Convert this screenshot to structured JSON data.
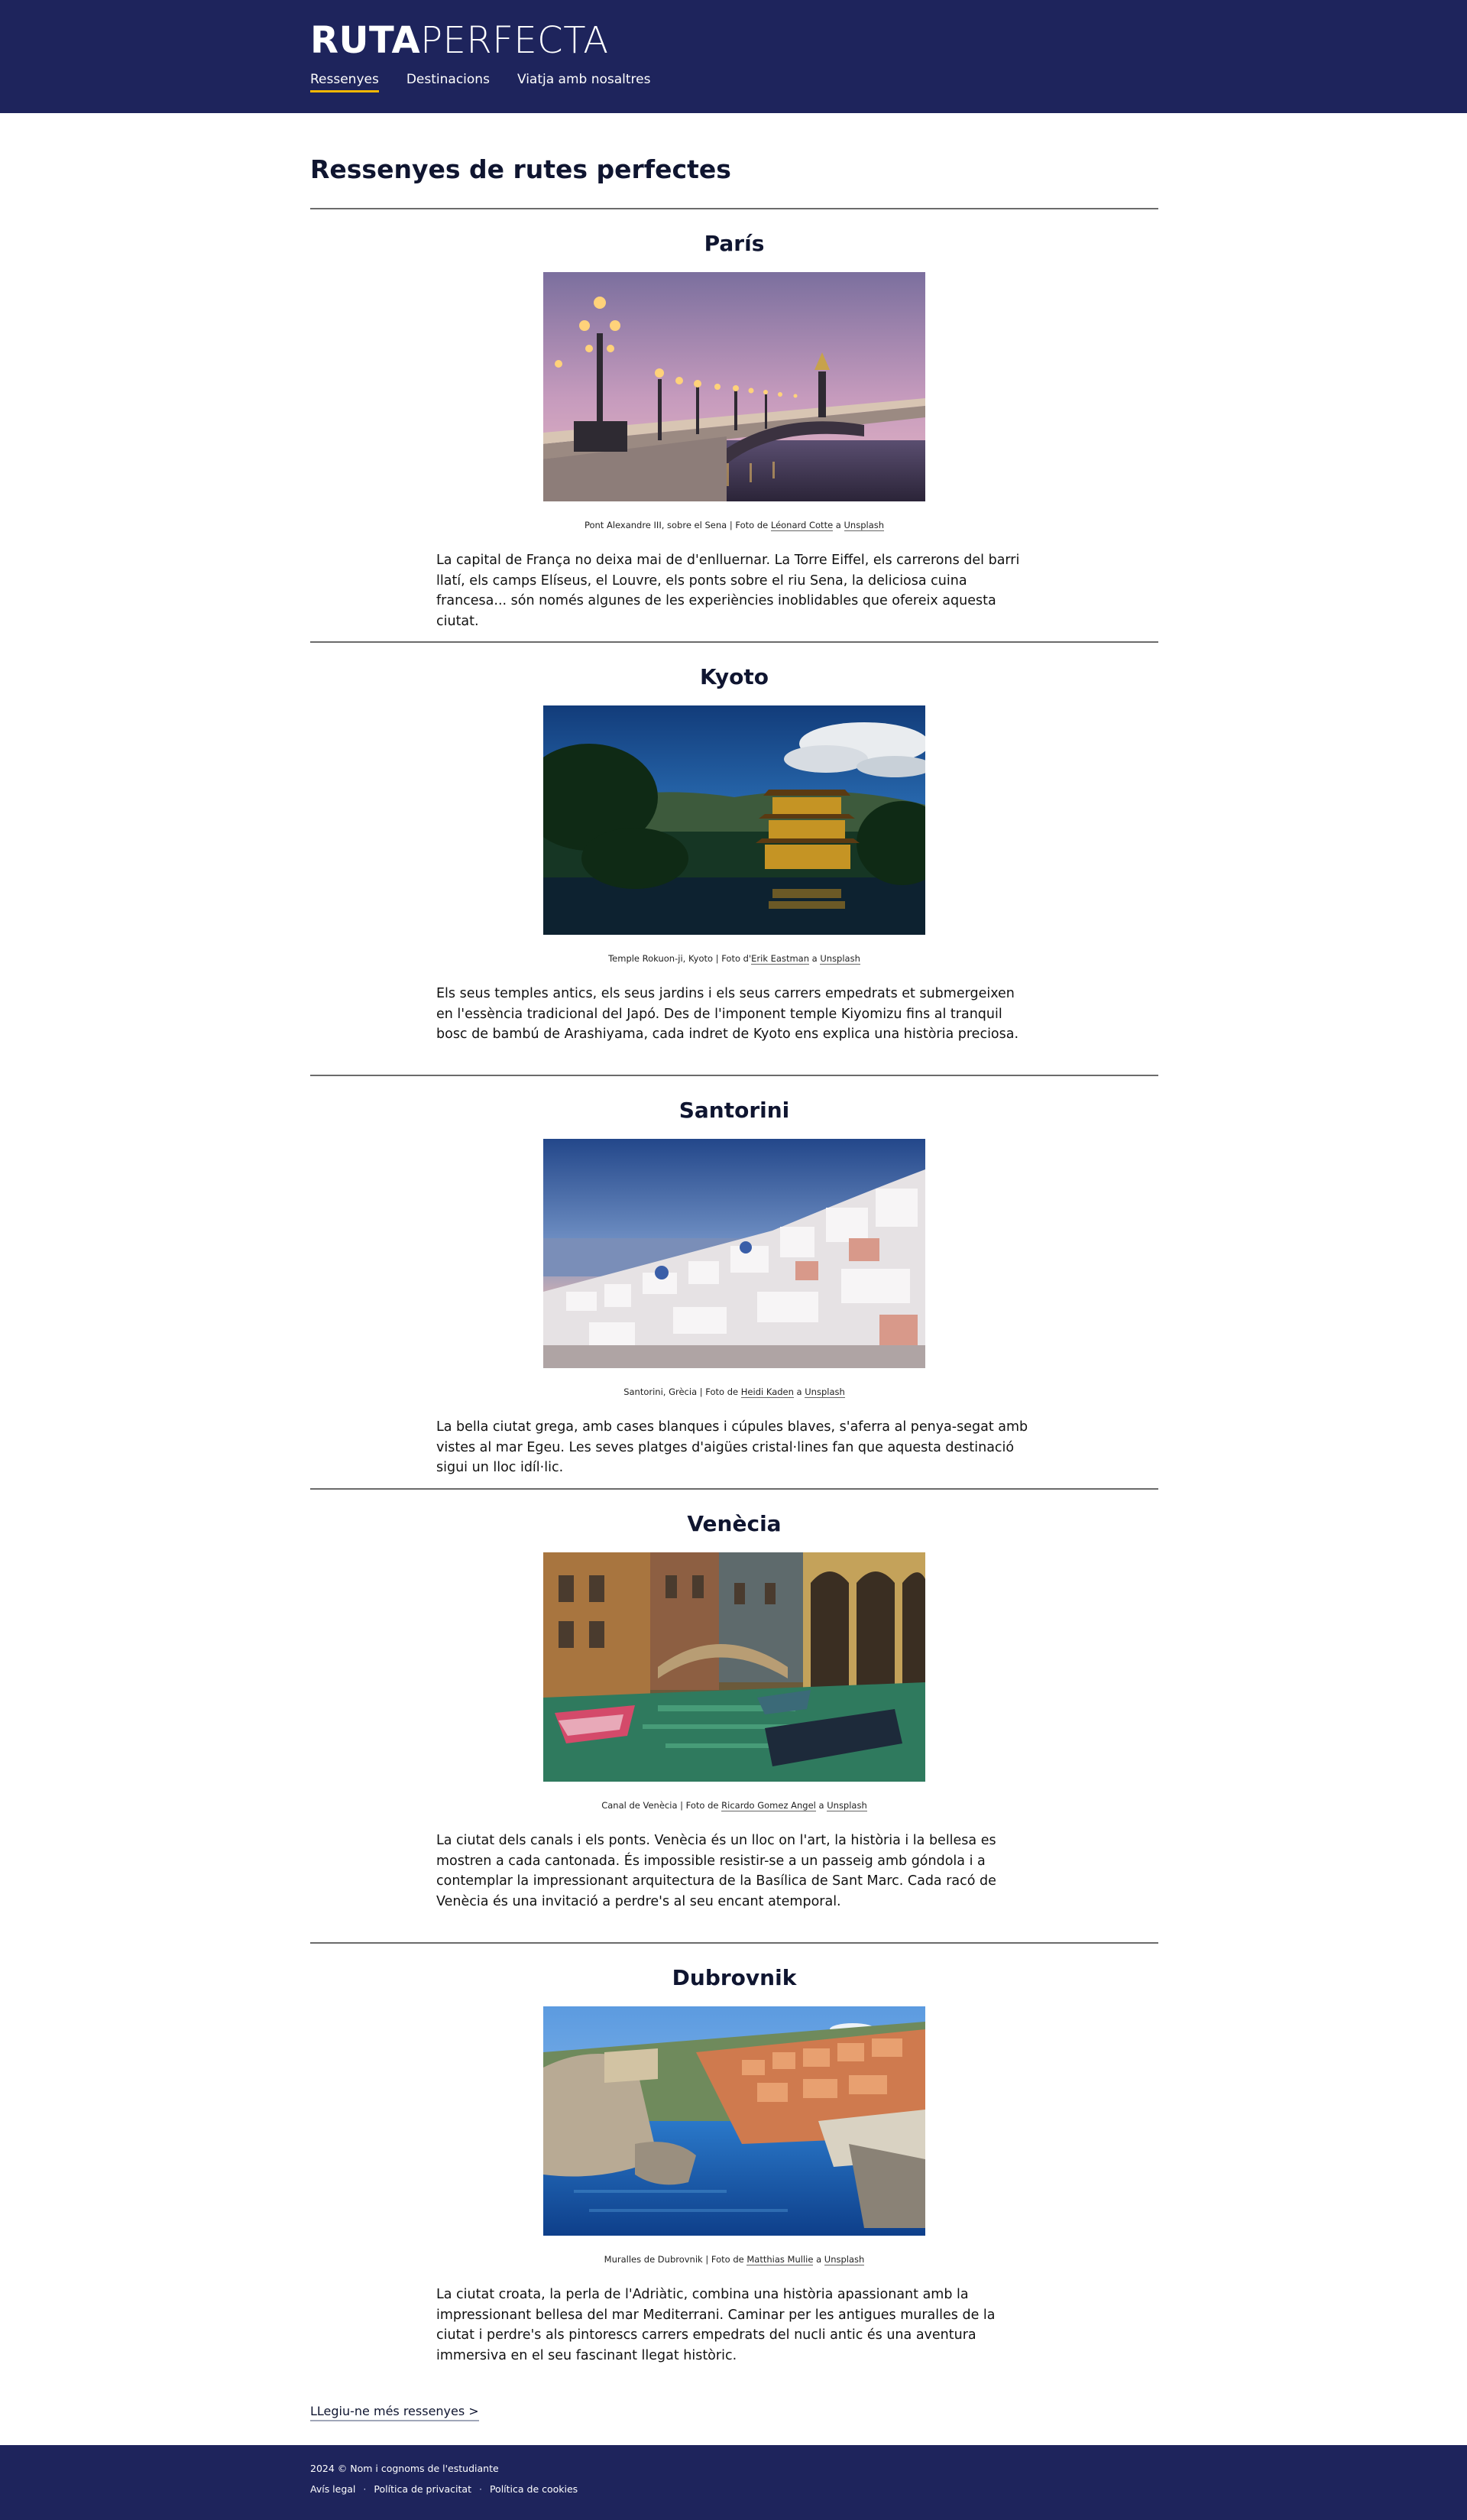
{
  "header": {
    "logo_bold": "RUTA",
    "logo_thin": "PERFECTA",
    "nav": [
      {
        "label": "Ressenyes"
      },
      {
        "label": "Destinacions"
      },
      {
        "label": "Viatja amb nosaltres"
      }
    ]
  },
  "main": {
    "title": "Ressenyes de rutes perfectes",
    "reviews": [
      {
        "title": "París",
        "caption_text": "Pont Alexandre III, sobre el Sena | Foto de ",
        "photographer": "Léonard Cotte",
        "caption_mid": " a ",
        "source": "Unsplash",
        "description": "La capital de França no deixa mai de d'enlluernar. La Torre Eiffel, els carrerons del barri llatí, els camps Elíseus, el Louvre, els ponts sobre el riu Sena, la deliciosa cuina francesa... són només algunes de les experiències inoblidables que ofereix aquesta ciutat."
      },
      {
        "title": "Kyoto",
        "caption_text": "Temple Rokuon-ji, Kyoto | Foto d'",
        "photographer": "Erik Eastman",
        "caption_mid": " a ",
        "source": "Unsplash",
        "description": "Els seus temples antics, els seus jardins i els seus carrers empedrats et submergeixen en l'essència tradicional del Japó. Des de l'imponent temple Kiyomizu fins al tranquil bosc de bambú de Arashiyama, cada indret de Kyoto ens explica una història preciosa."
      },
      {
        "title": "Santorini",
        "caption_text": "Santorini, Grècia | Foto de ",
        "photographer": "Heidi Kaden",
        "caption_mid": " a ",
        "source": "Unsplash",
        "description": "La bella ciutat grega, amb cases blanques i cúpules blaves, s'aferra al penya-segat amb vistes al mar Egeu. Les seves platges d'aigües cristal·lines fan que aquesta destinació sigui un lloc idíl·lic."
      },
      {
        "title": "Venècia",
        "caption_text": "Canal de Venècia | Foto de ",
        "photographer": "Ricardo Gomez Angel",
        "caption_mid": " a ",
        "source": "Unsplash",
        "description": "La ciutat dels canals i els ponts. Venècia és un lloc on l'art, la història i la bellesa es mostren a cada cantonada. És impossible resistir-se a un passeig amb góndola i a contemplar la impressionant arquitectura de la Basílica de Sant Marc. Cada racó de Venècia és una invitació a perdre's al seu encant atemporal."
      },
      {
        "title": "Dubrovnik",
        "caption_text": "Muralles de Dubrovnik | Foto de ",
        "photographer": "Matthias Mullie",
        "caption_mid": " a ",
        "source": "Unsplash",
        "description": "La ciutat croata, la perla de l'Adriàtic, combina una història apassionant amb la impressionant bellesa del mar Mediterrani. Caminar per les antigues muralles de la ciutat i perdre's als pintorescs carrers empedrats del nucli antic és una aventura immersiva en el seu fascinant llegat històric."
      }
    ],
    "more_link": "LLegiu-ne més ressenyes  >"
  },
  "footer": {
    "copyright": "2024 © Nom i cognoms de l'estudiante",
    "links": [
      "Avís legal",
      "Política de privacitat",
      "Política de cookies"
    ],
    "separator": "·"
  },
  "colors": {
    "header_bg": "#1e245c",
    "nav_active_underline": "#f5b700",
    "divider": "#6b6b6b"
  }
}
